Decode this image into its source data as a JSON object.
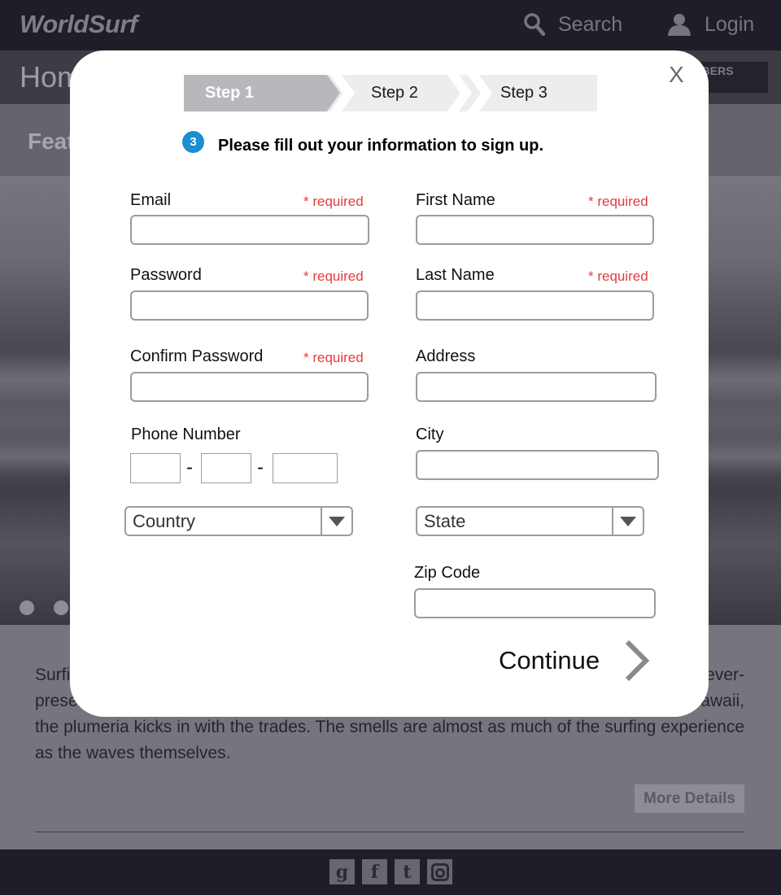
{
  "header": {
    "logo": "WorldSurf",
    "search_label": "Search",
    "login_label": "Login"
  },
  "homebar": {
    "title": "Home",
    "members_label": "MEMBERS ONLY"
  },
  "featured": {
    "title": "Featured"
  },
  "article": {
    "paragraph": "Surfing is about more than just the waves. In Southern California, the smell of sea salt is ever-present; in Northern California, the smell of eucalyptus wafts out to the lineup and in Hawaii, the plumeria kicks in with the trades. The smells are almost as much of the surfing experience as the waves themselves.",
    "more_details_label": "More Details"
  },
  "footer": {
    "social_icons": [
      "google-plus-icon",
      "facebook-icon",
      "twitter-icon",
      "instagram-icon"
    ]
  },
  "modal": {
    "close_label": "X",
    "steps": [
      {
        "label": "Step 1",
        "active": true
      },
      {
        "label": "Step 2",
        "active": false
      },
      {
        "label": "Step 3",
        "active": false
      }
    ],
    "badge_number": "3",
    "instruction": "Please fill out your information to sign up.",
    "required_text": "* required",
    "fields": {
      "email": {
        "label": "Email",
        "value": ""
      },
      "password": {
        "label": "Password",
        "value": ""
      },
      "confirm_password": {
        "label": "Confirm Password",
        "value": ""
      },
      "phone": {
        "label": "Phone Number",
        "separator": "-"
      },
      "first_name": {
        "label": "First Name",
        "value": ""
      },
      "last_name": {
        "label": "Last Name",
        "value": ""
      },
      "address": {
        "label": "Address",
        "value": ""
      },
      "city": {
        "label": "City",
        "value": ""
      },
      "zip": {
        "label": "Zip Code",
        "value": ""
      }
    },
    "country_select": "Country",
    "state_select": "State",
    "continue_label": "Continue"
  },
  "colors": {
    "accent_badge": "#1a8ed0",
    "required_red": "#e53c3c",
    "active_step": "#b8b8bc"
  }
}
